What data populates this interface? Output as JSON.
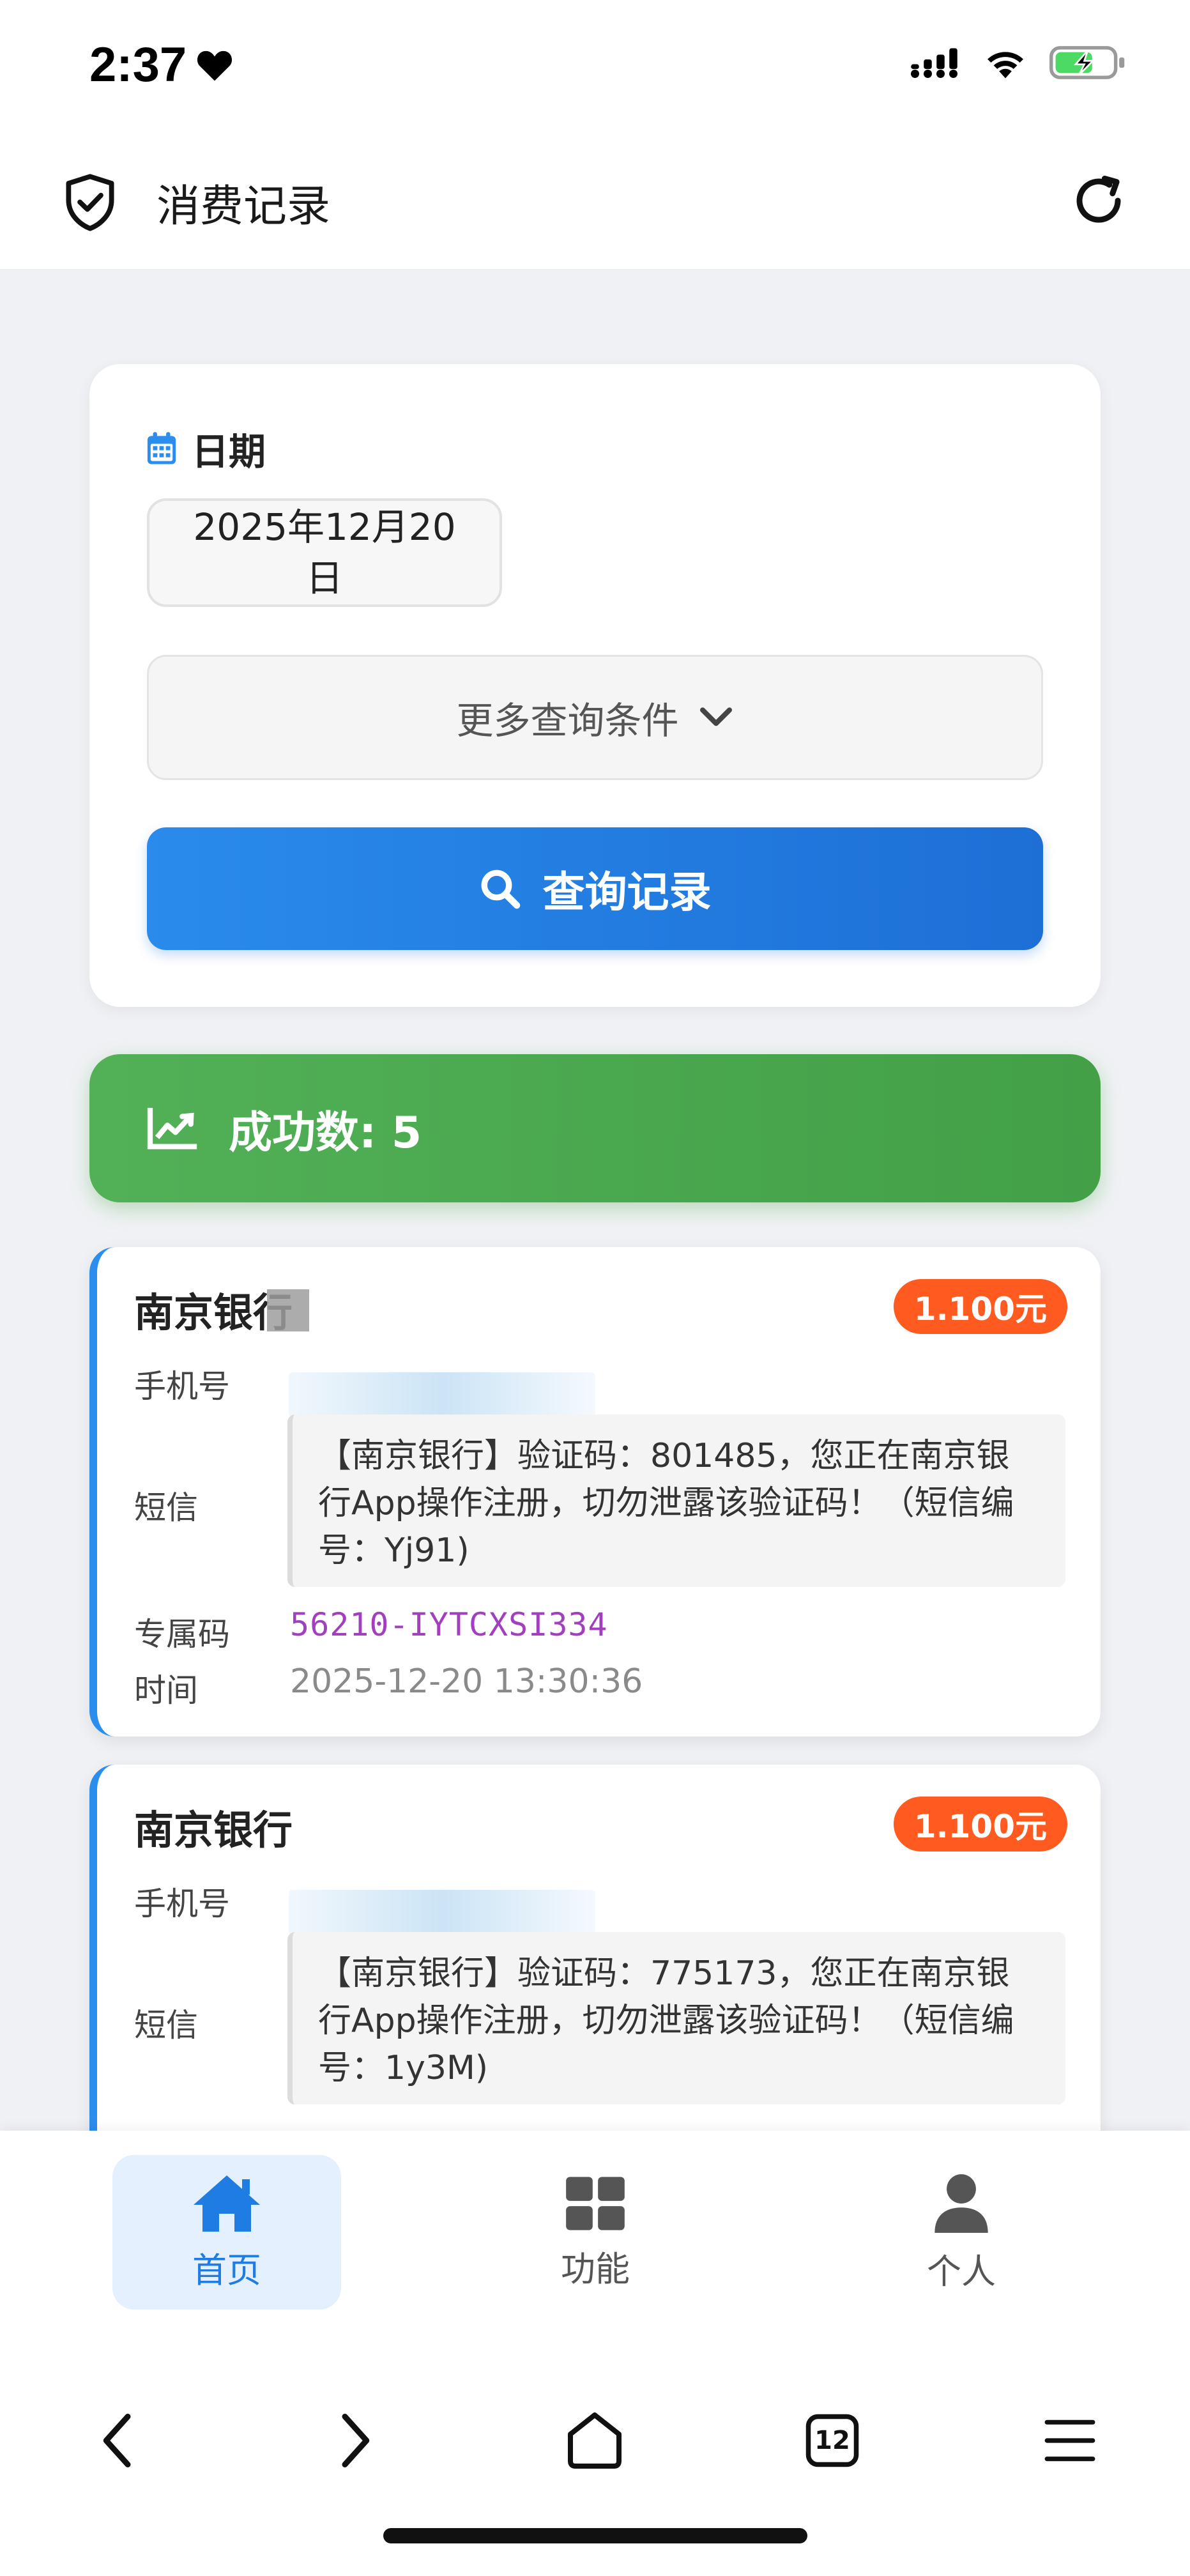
{
  "status_bar": {
    "time": "2:37"
  },
  "header": {
    "title": "消费记录"
  },
  "search": {
    "date_label": "日期",
    "date_value": "2025年12月20日",
    "more_conditions_label": "更多查询条件",
    "query_button_label": "查询记录"
  },
  "summary": {
    "success_text": "成功数: 5"
  },
  "records": [
    {
      "bank": "南京银行",
      "price": "1.100元",
      "phone_label": "手机号",
      "sms_label": "短信",
      "sms": "【南京银行】验证码：801485，您正在南京银行App操作注册，切勿泄露该验证码！（短信编号：Yj91)",
      "code_label": "专属码",
      "code": "56210-IYTCXSI334",
      "time_label": "时间",
      "time": "2025-12-20 13:30:36"
    },
    {
      "bank": "南京银行",
      "price": "1.100元",
      "phone_label": "手机号",
      "sms_label": "短信",
      "sms": "【南京银行】验证码：775173，您正在南京银行App操作注册，切勿泄露该验证码！（短信编号：1y3M)"
    }
  ],
  "nav": {
    "items": [
      {
        "label": "首页",
        "icon": "home-icon"
      },
      {
        "label": "功能",
        "icon": "grid-icon"
      },
      {
        "label": "个人",
        "icon": "person-icon"
      }
    ]
  },
  "browser": {
    "tab_count": "12"
  },
  "colors": {
    "primary": "#1f7ce3",
    "success": "#4caf50",
    "badge": "#ff5a1f",
    "code": "#a23fbf"
  }
}
